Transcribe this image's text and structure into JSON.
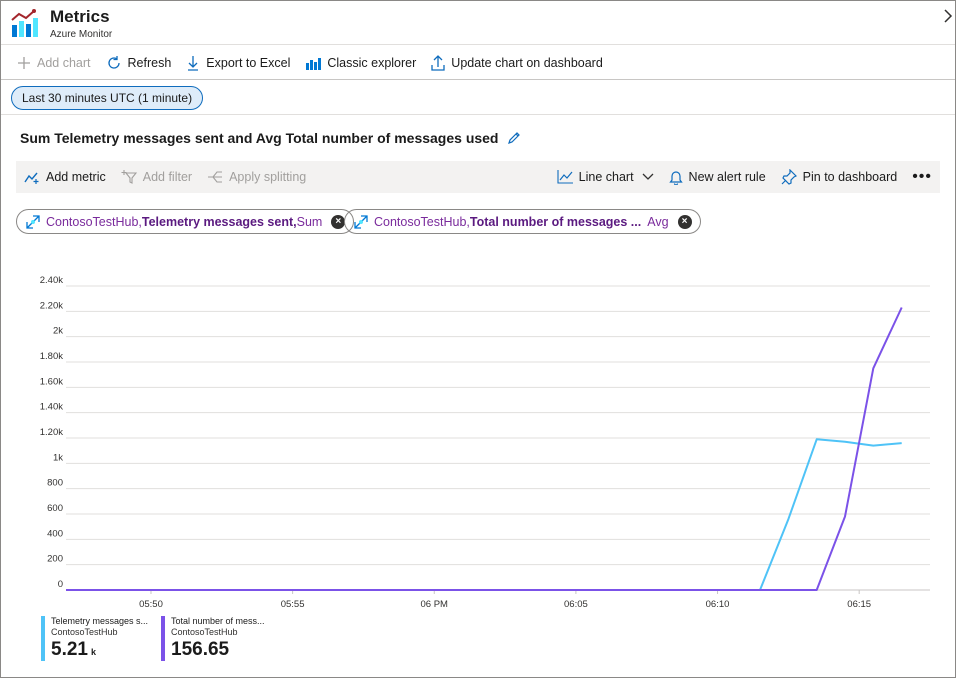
{
  "header": {
    "title": "Metrics",
    "subtitle": "Azure Monitor"
  },
  "toolbar": {
    "add_chart": "Add chart",
    "refresh": "Refresh",
    "export": "Export to Excel",
    "classic": "Classic explorer",
    "update": "Update chart on dashboard"
  },
  "time_range": "Last 30 minutes UTC (1 minute)",
  "chart_title": "Sum Telemetry messages sent and Avg Total number of messages used",
  "chart_toolbar": {
    "add_metric": "Add metric",
    "add_filter": "Add filter",
    "apply_splitting": "Apply splitting",
    "line_chart": "Line chart",
    "new_alert": "New alert rule",
    "pin": "Pin to dashboard",
    "more": "•••"
  },
  "metric_pills": [
    {
      "resource": "ContosoTestHub, ",
      "metric": "Telemetry messages sent, ",
      "aggregation": "Sum"
    },
    {
      "resource": "ContosoTestHub, ",
      "metric": "Total number of messages ...",
      "aggregation": "Avg"
    }
  ],
  "colors": {
    "series1": "#4fc3f7",
    "series2": "#7b52e8",
    "accent": "#0f6cbd"
  },
  "chart_data": {
    "type": "line",
    "y_ticks": [
      "0",
      "200",
      "400",
      "600",
      "800",
      "1k",
      "1.20k",
      "1.40k",
      "1.60k",
      "1.80k",
      "2k",
      "2.20k",
      "2.40k"
    ],
    "ylim": [
      0,
      2400
    ],
    "x_ticks": [
      "05:50",
      "05:55",
      "06 PM",
      "06:05",
      "06:10",
      "06:15"
    ],
    "x_tick_minutes": [
      50,
      55,
      60,
      65,
      70,
      75
    ],
    "xlim": [
      47,
      77.5
    ],
    "grid": true,
    "series": [
      {
        "name": "Telemetry messages s...",
        "resource": "ContosoTestHub",
        "total": "5.21",
        "unit": "k",
        "points": [
          [
            47,
            0
          ],
          [
            71.5,
            0
          ],
          [
            72.5,
            560
          ],
          [
            73.5,
            1190
          ],
          [
            74.5,
            1170
          ],
          [
            75.5,
            1140
          ],
          [
            76.5,
            1160
          ]
        ]
      },
      {
        "name": "Total number of mess...",
        "resource": "ContosoTestHub",
        "total": "156.65",
        "unit": "",
        "points": [
          [
            47,
            0
          ],
          [
            73.5,
            0
          ],
          [
            74.5,
            580
          ],
          [
            75.5,
            1750
          ],
          [
            76.5,
            2230
          ]
        ]
      }
    ]
  }
}
